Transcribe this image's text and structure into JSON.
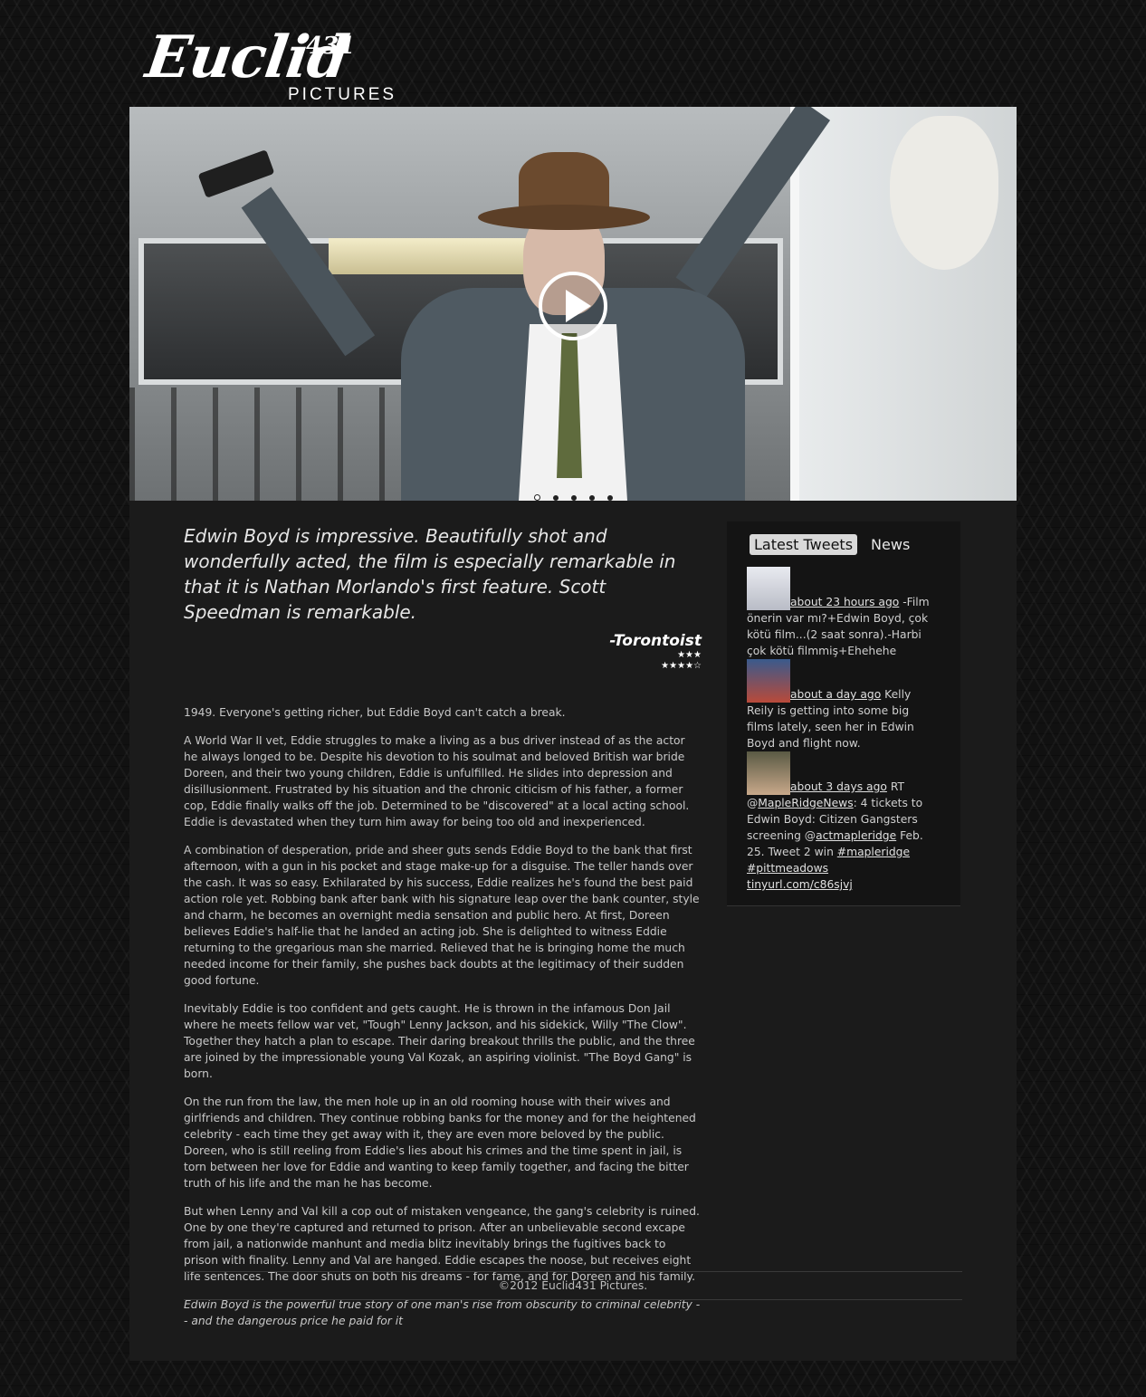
{
  "logo": {
    "script": "Euclid",
    "number": "431",
    "subtitle": "PICTURES"
  },
  "hero": {
    "slides": 5,
    "active_slide": 1
  },
  "review": {
    "quote": "Edwin Boyd is impressive. Beautifully shot and wonderfully acted, the film is especially remarkable in that it is Nathan Morlando's first feature. Scott Speedman is remarkable.",
    "source": "-Torontoist",
    "stars_line1": "★★★",
    "stars_line2": "★★★★☆"
  },
  "synopsis": {
    "p1": "1949. Everyone's getting richer, but Eddie Boyd can't catch a break.",
    "p2": "A World War II vet, Eddie struggles to make a living as a bus driver instead of as the actor he always longed to be. Despite his devotion to his soulmat and beloved British war bride Doreen, and their two young children, Eddie is unfulfilled. He slides into depression and disillusionment. Frustrated by his situation and the chronic citicism of his father, a former cop, Eddie finally walks off the job. Determined to be \"discovered\" at a local acting school. Eddie is devastated when they turn him away for being too old and inexperienced.",
    "p3": "A combination of desperation, pride and sheer guts sends Eddie Boyd to the bank that first afternoon, with a gun in his pocket and stage make-up for a disguise. The teller hands over the cash. It was so easy. Exhilarated by his success, Eddie realizes he's found the best paid action role yet. Robbing bank after bank with his signature leap over the bank counter, style and charm, he becomes an overnight media sensation and public hero. At first, Doreen believes Eddie's half-lie that he landed an acting job. She is delighted to witness Eddie returning to the gregarious man she married. Relieved that he is bringing home the much needed income for their family, she pushes back doubts at the legitimacy of their sudden good fortune.",
    "p4": "Inevitably Eddie is too confident and gets caught. He is thrown in the infamous Don Jail where he meets fellow war vet, \"Tough\" Lenny Jackson, and his sidekick, Willy \"The Clow\". Together they hatch a plan to escape. Their daring breakout thrills the public, and the three are joined by the impressionable young Val Kozak, an aspiring violinist. \"The Boyd Gang\" is born.",
    "p5": "On the run from the law, the men hole up in an old rooming house with their wives and girlfriends and children. They continue robbing banks for the money and for the heightened celebrity - each time they get away with it, they are even more beloved by the public. Doreen, who is still reeling from Eddie's lies about his crimes and the time spent in jail, is torn between her love for Eddie and wanting to keep family together, and facing the bitter truth of his life and the man he has become.",
    "p6": "But when Lenny and Val kill a cop out of mistaken vengeance, the gang's celebrity is ruined. One by one they're captured and returned to prison. After an unbelievable second excape from jail, a nationwide manhunt and media blitz inevitably brings the fugitives back to prison with finality. Lenny and Val are hanged. Eddie escapes the noose, but receives eight life sentences. The door shuts on both his dreams - for fame, and for Doreen and his family.",
    "tagline": "Edwin Boyd is the powerful true story of one man's rise from obscurity to criminal celebrity -- and the dangerous price he paid for it"
  },
  "sidebar": {
    "tabs": [
      "Latest Tweets",
      "News"
    ],
    "active_tab": "Latest Tweets",
    "tweets": [
      {
        "time": "about 23 hours ago",
        "text": " -Film önerin var mı?+Edwin Boyd, çok kötü film...(2 saat sonra).-Harbi çok kötü filmmiş+Ehehehe",
        "avatar_color": "#d8dbe2"
      },
      {
        "time": "about a day ago",
        "text": " Kelly Reily is getting into some big films lately, seen her in Edwin Boyd and flight now.",
        "avatar_color": "#8a3b3b"
      },
      {
        "time": "about 3 days ago",
        "text_a": " RT @",
        "link1": "MapleRidgeNews",
        "text_b": ": 4 tickets to Edwin Boyd: Citizen Gangsters screening @",
        "link2": "actmapleridge",
        "text_c": " Feb. 25. Tweet 2 win ",
        "link3": "#mapleridge",
        "text_d": " ",
        "link4": "#pittmeadows",
        "text_e": " ",
        "link5": "tinyurl.com/c86sjvj",
        "avatar_color": "#6b6b55"
      }
    ]
  },
  "footer": {
    "copyright": "©2012 Euclid431 Pictures."
  }
}
